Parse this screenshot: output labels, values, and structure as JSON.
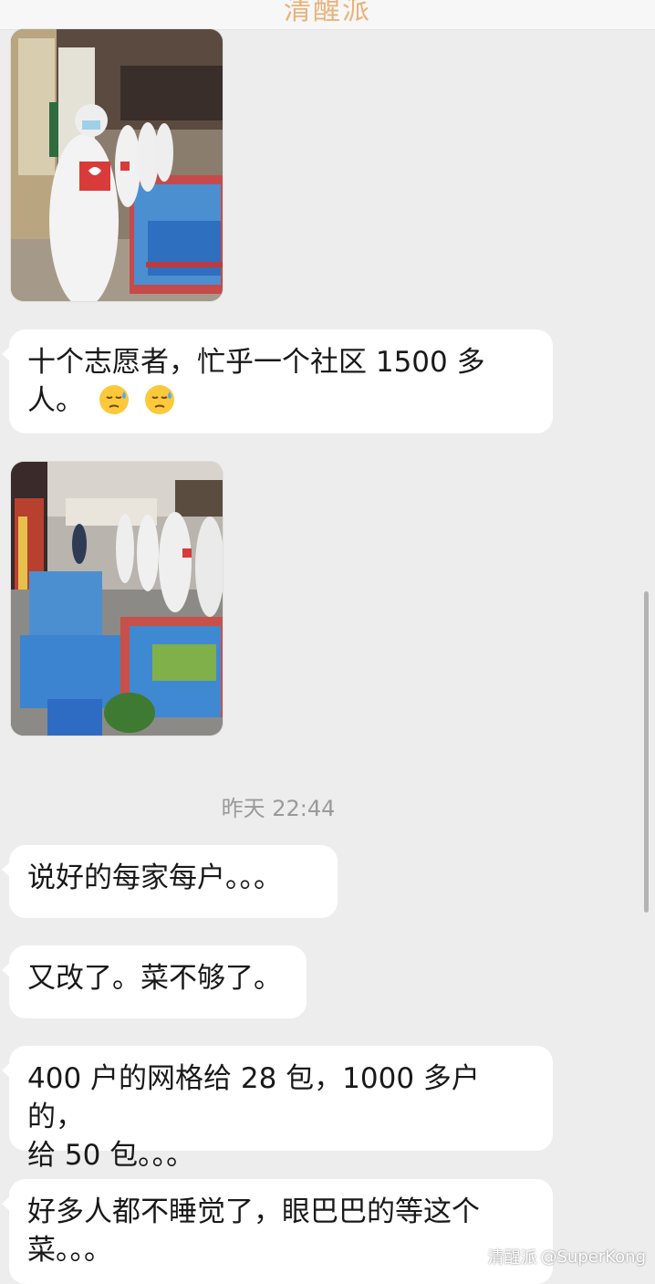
{
  "header": {
    "title": "清醒派"
  },
  "messages": {
    "m1": {
      "line1": "十个志愿者，忙乎一个社区 1500 多",
      "line2": "人。"
    },
    "emoji_name": "cold-sweat-face-icon",
    "timestamp": "昨天 22:44",
    "m2": {
      "text": "说好的每家每户。。。"
    },
    "m3": {
      "text": "又改了。菜不够了。"
    },
    "m4": {
      "line1": "400 户的网格给 28 包，1000 多户的，",
      "line2": "给 50 包。。。"
    },
    "m5": {
      "line1": "好多人都不睡觉了，眼巴巴的等这个",
      "line2": "菜。。。"
    }
  },
  "watermark": {
    "source": "清醒派",
    "handle": "@SuperKong"
  },
  "colors": {
    "background": "#ededed",
    "bubble": "#ffffff",
    "text": "#191919",
    "timestamp": "#9a9a9a"
  }
}
